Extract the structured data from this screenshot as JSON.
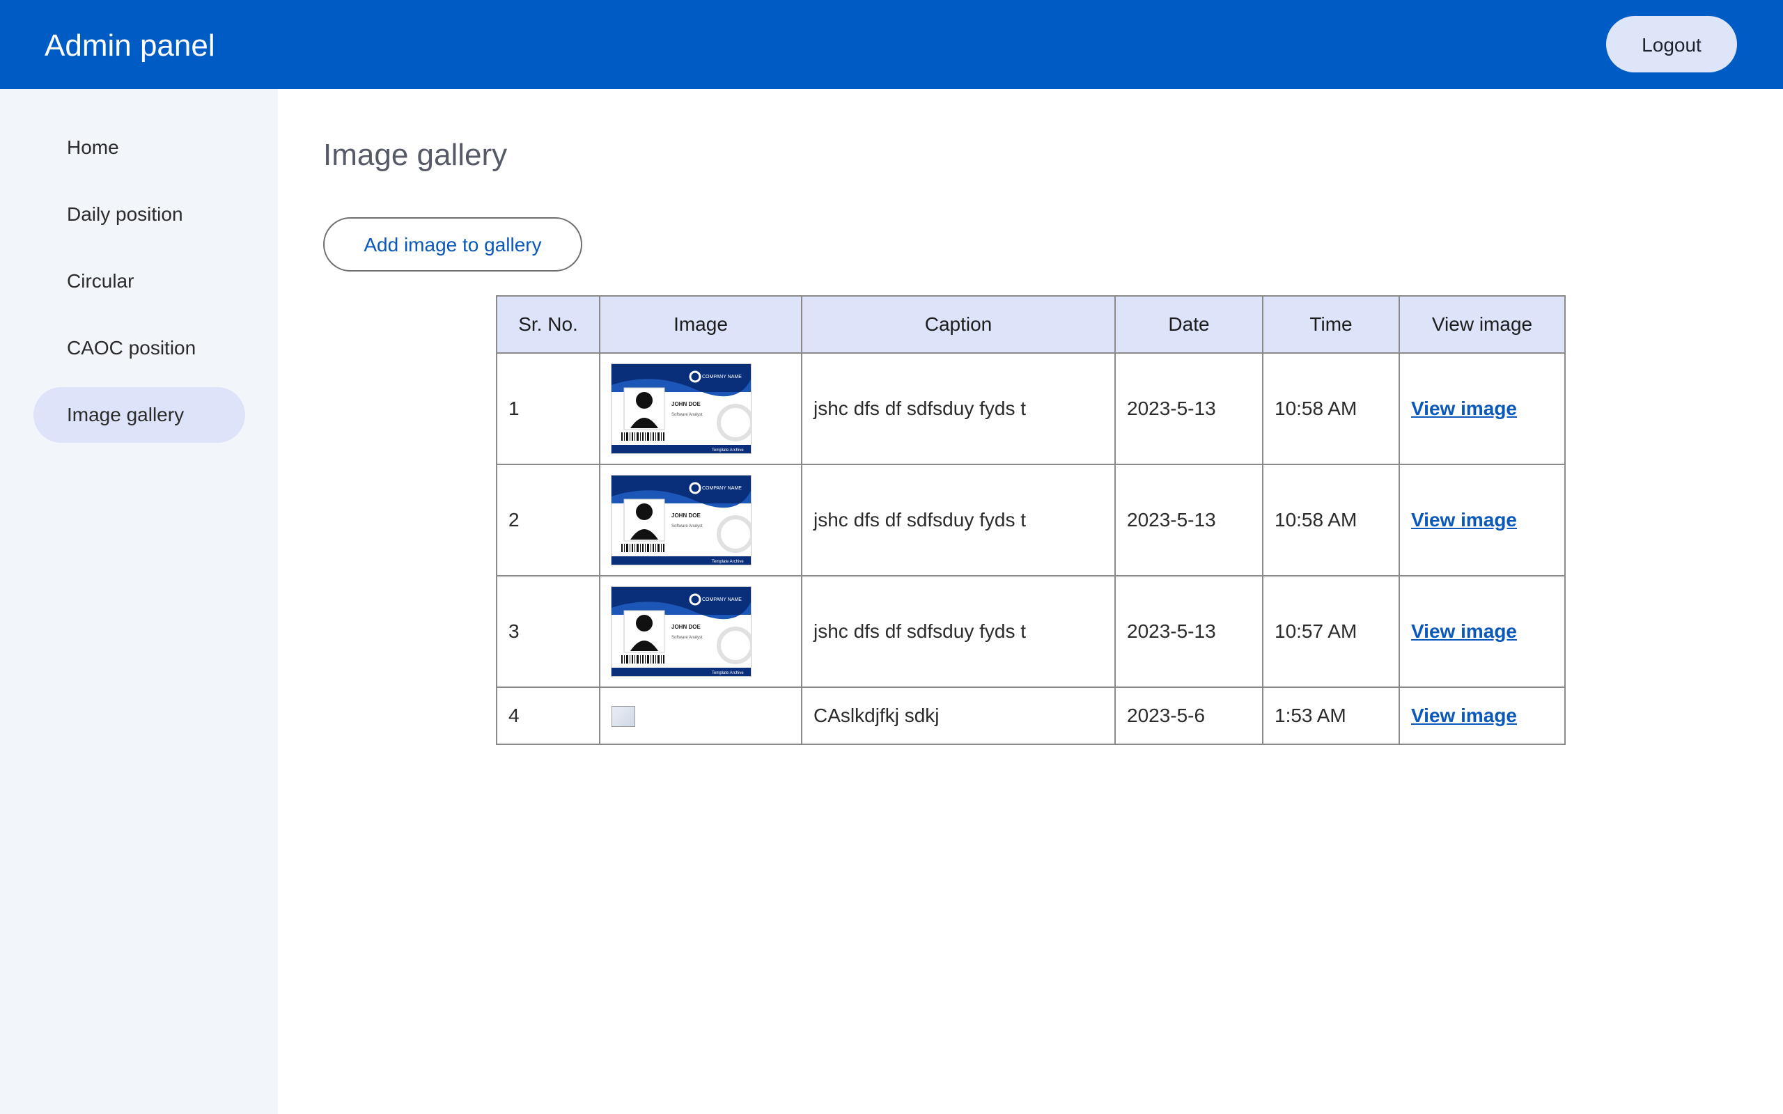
{
  "app": {
    "title": "Admin panel",
    "logout_label": "Logout"
  },
  "sidebar": {
    "items": [
      {
        "label": "Home",
        "active": false
      },
      {
        "label": "Daily position",
        "active": false
      },
      {
        "label": "Circular",
        "active": false
      },
      {
        "label": "CAOC position",
        "active": false
      },
      {
        "label": "Image gallery",
        "active": true
      }
    ]
  },
  "main": {
    "title": "Image gallery",
    "add_button_label": "Add image to gallery",
    "table": {
      "headers": [
        "Sr. No.",
        "Image",
        "Caption",
        "Date",
        "Time",
        "View image"
      ],
      "rows": [
        {
          "sr": "1",
          "image": "id-card-thumbnail",
          "caption": "jshc dfs df sdfsduy fyds t",
          "date": "2023-5-13",
          "time": "10:58 AM",
          "link": "View image"
        },
        {
          "sr": "2",
          "image": "id-card-thumbnail",
          "caption": "jshc dfs df sdfsduy fyds t",
          "date": "2023-5-13",
          "time": "10:58 AM",
          "link": "View image"
        },
        {
          "sr": "3",
          "image": "id-card-thumbnail",
          "caption": "jshc dfs df sdfsduy fyds t",
          "date": "2023-5-13",
          "time": "10:57 AM",
          "link": "View image"
        },
        {
          "sr": "4",
          "image": "broken-image-icon",
          "caption": "CAslkdjfkj sdkj",
          "date": "2023-5-6",
          "time": "1:53 AM",
          "link": "View image"
        }
      ]
    }
  },
  "id_card": {
    "company": "COMPANY NAME",
    "name": "JOHN DOE",
    "role": "Software Analyst",
    "footer": "Template Archive"
  },
  "colors": {
    "header_bg": "#005cc5",
    "sidebar_bg": "#f2f6fb",
    "active_item_bg": "#dde3f8",
    "table_header_bg": "#dde3f8",
    "link": "#0a58ba"
  }
}
